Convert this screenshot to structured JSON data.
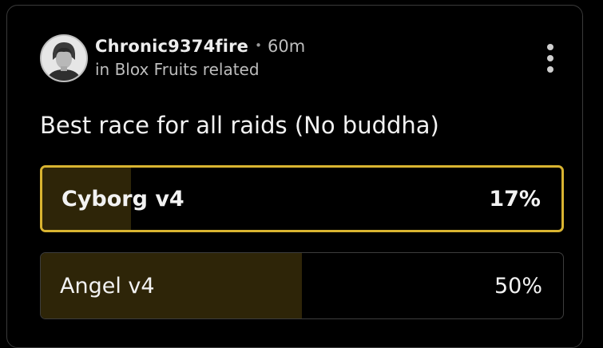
{
  "post": {
    "author": "Chronic9374fire",
    "separator": "•",
    "time": "60m",
    "community": "in Blox Fruits related",
    "title": "Best race for all raids (No buddha)"
  },
  "poll": {
    "accent_color": "#d9b431",
    "fill_color": "#2e2508",
    "options": [
      {
        "label": "Cyborg v4",
        "percent_text": "17%",
        "percent": 17,
        "selected": true
      },
      {
        "label": "Angel v4",
        "percent_text": "50%",
        "percent": 50,
        "selected": false
      }
    ]
  },
  "icons": {
    "more": "more-vertical-icon",
    "avatar": "user-avatar"
  }
}
